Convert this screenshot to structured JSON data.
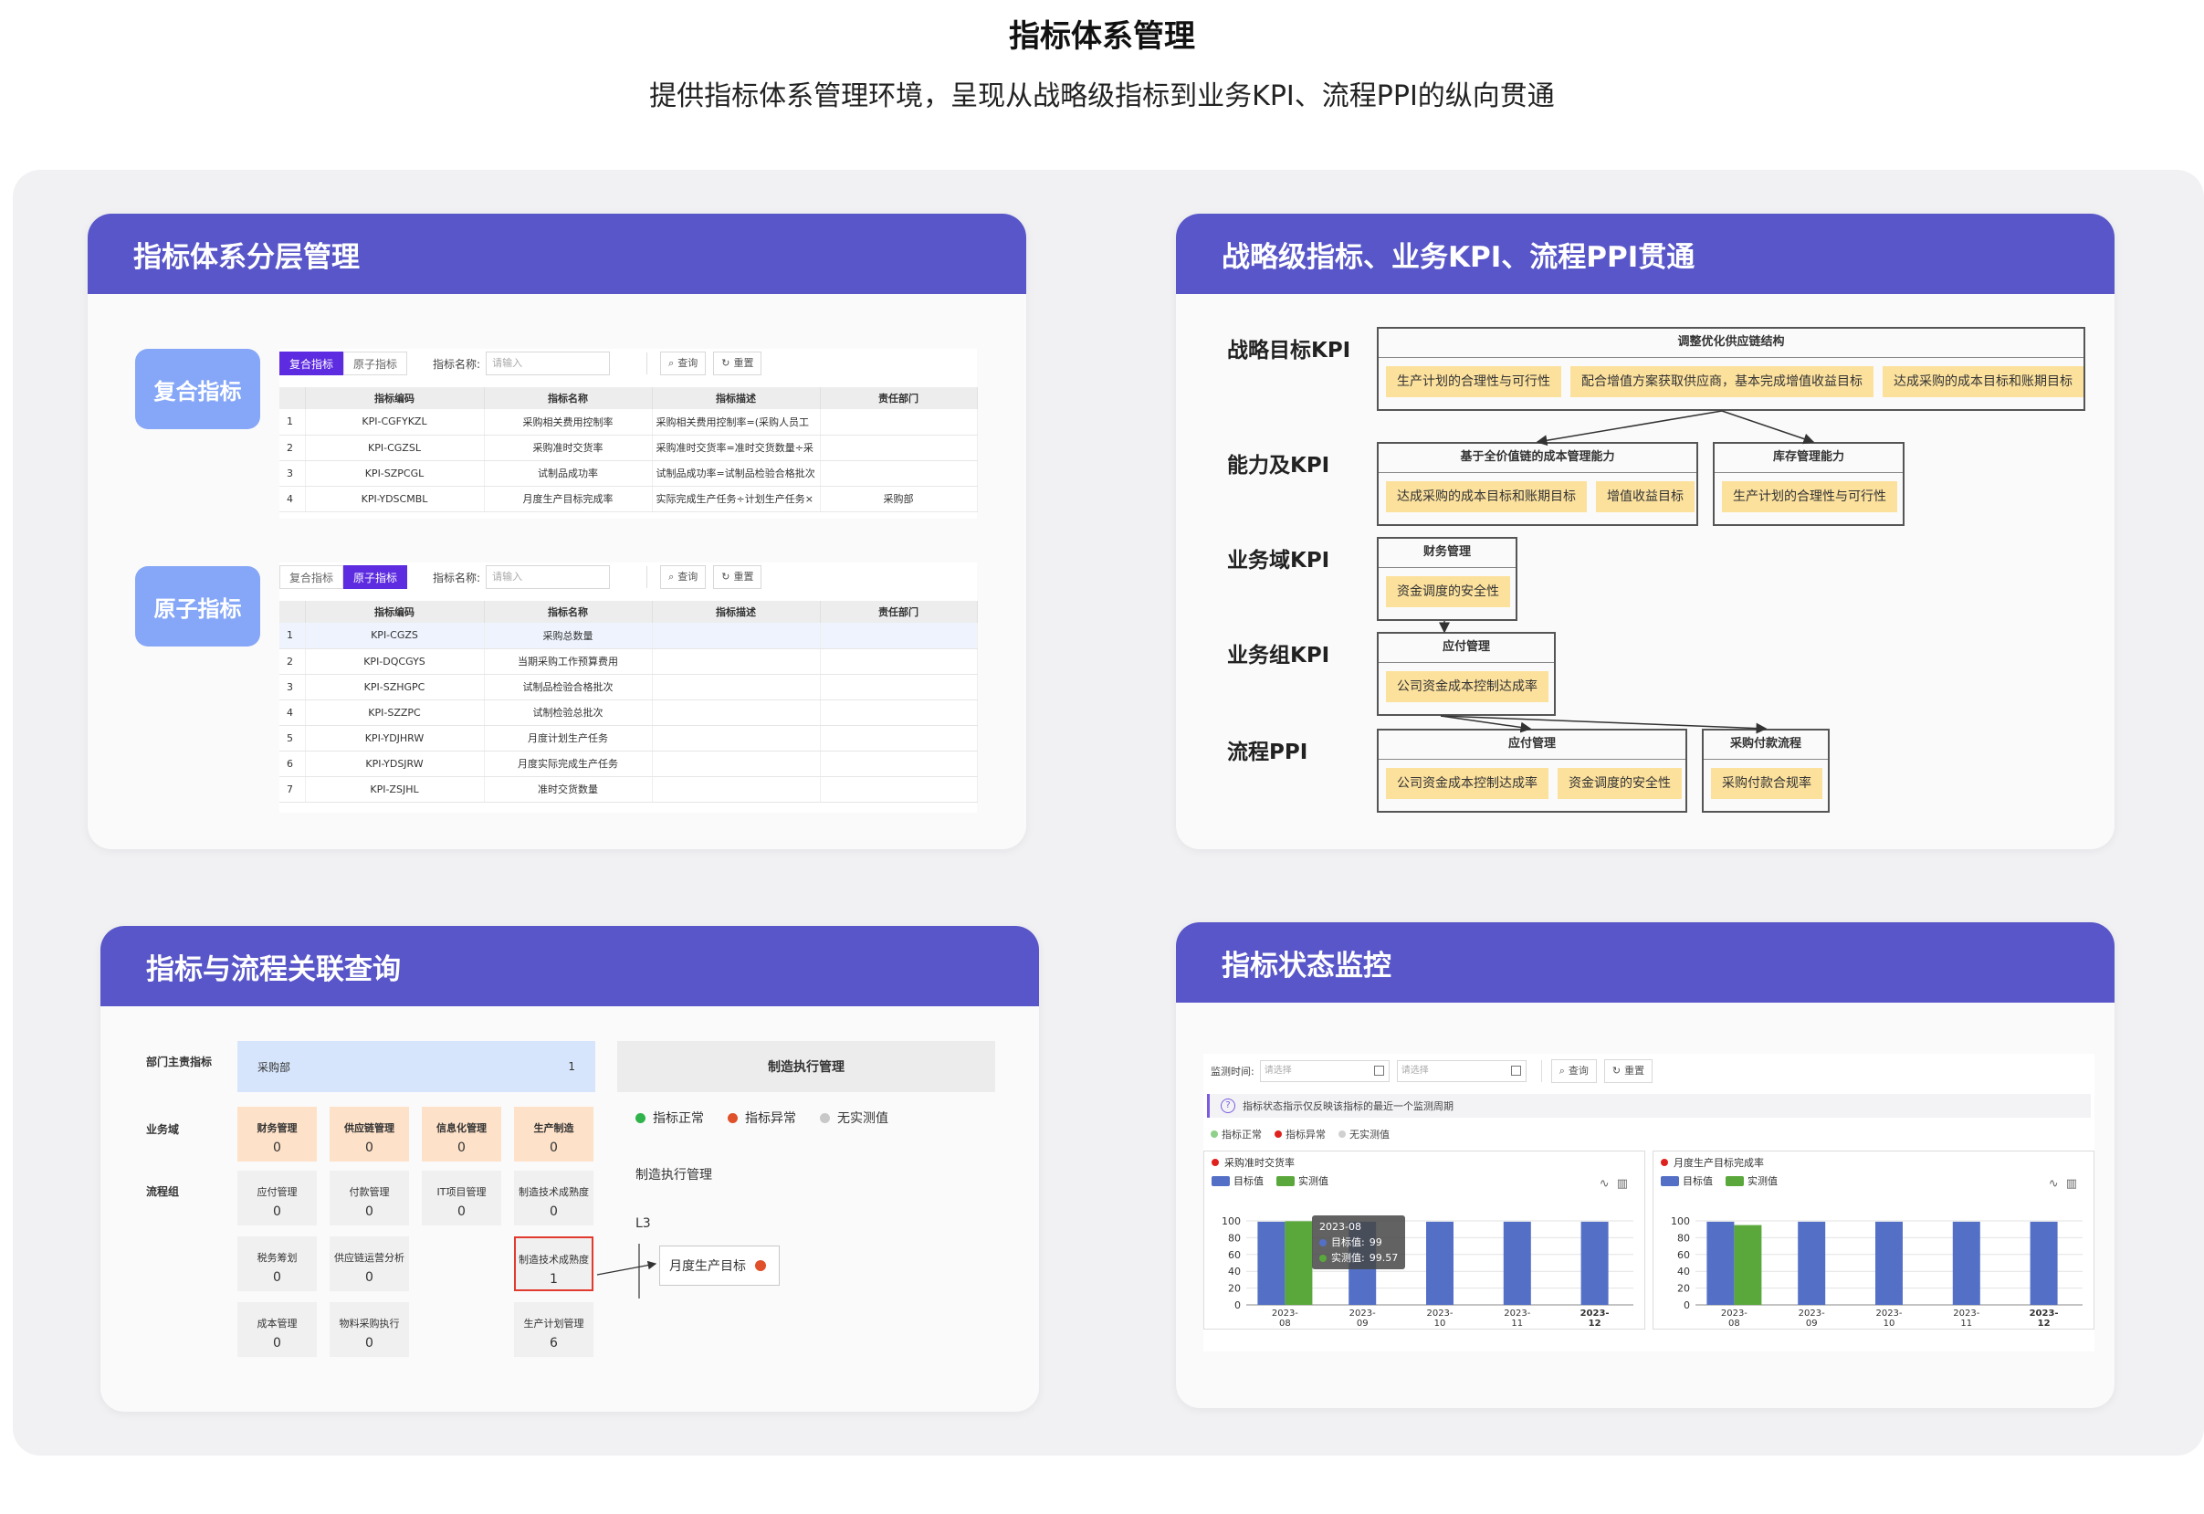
{
  "page": {
    "title": "指标体系管理",
    "subtitle": "提供指标体系管理环境，呈现从战略级指标到业务KPI、流程PPI的纵向贯通"
  },
  "card1": {
    "title": "指标体系分层管理",
    "composite_label": "复合指标",
    "atomic_label": "原子指标",
    "tabs": [
      "复合指标",
      "原子指标"
    ],
    "name_label": "指标名称:",
    "placeholder": "请输入",
    "query": "查询",
    "reset": "重置",
    "columns": [
      "",
      "指标编码",
      "指标名称",
      "指标描述",
      "责任部门"
    ],
    "composite_rows": [
      [
        "1",
        "KPI-CGFYKZL",
        "采购相关费用控制率",
        "采购相关费用控制率=(采购人员工",
        ""
      ],
      [
        "2",
        "KPI-CGZSL",
        "采购准时交货率",
        "采购准时交货率=准时交货数量÷采",
        ""
      ],
      [
        "3",
        "KPI-SZPCGL",
        "试制品成功率",
        "试制品成功率=试制品检验合格批次",
        ""
      ],
      [
        "4",
        "KPI-YDSCMBL",
        "月度生产目标完成率",
        "实际完成生产任务÷计划生产任务×",
        "采购部"
      ]
    ],
    "atomic_rows": [
      [
        "1",
        "KPI-CGZS",
        "采购总数量",
        "",
        ""
      ],
      [
        "2",
        "KPI-DQCGYS",
        "当期采购工作预算费用",
        "",
        ""
      ],
      [
        "3",
        "KPI-SZHGPC",
        "试制品检验合格批次",
        "",
        ""
      ],
      [
        "4",
        "KPI-SZZPC",
        "试制检验总批次",
        "",
        ""
      ],
      [
        "5",
        "KPI-YDJHRW",
        "月度计划生产任务",
        "",
        ""
      ],
      [
        "6",
        "KPI-YDSJRW",
        "月度实际完成生产任务",
        "",
        ""
      ],
      [
        "7",
        "KPI-ZSJHL",
        "准时交货数量",
        "",
        ""
      ]
    ]
  },
  "card2": {
    "title": "战略级指标、业务KPI、流程PPI贯通",
    "levels": [
      "战略目标KPI",
      "能力及KPI",
      "业务域KPI",
      "业务组KPI",
      "流程PPI"
    ],
    "strategy": {
      "title": "调整优化供应链结构",
      "items": [
        "生产计划的合理性与可行性",
        "配合增值方案获取供应商，基本完成增值收益目标",
        "达成采购的成本目标和账期目标"
      ]
    },
    "ability1": {
      "title": "基于全价值链的成本管理能力",
      "items": [
        "达成采购的成本目标和账期目标",
        "增值收益目标"
      ]
    },
    "ability2": {
      "title": "库存管理能力",
      "items": [
        "生产计划的合理性与可行性"
      ]
    },
    "domain": {
      "title": "财务管理",
      "items": [
        "资金调度的安全性"
      ]
    },
    "group": {
      "title": "应付管理",
      "items": [
        "公司资金成本控制达成率"
      ]
    },
    "ppi1": {
      "title": "应付管理",
      "items": [
        "公司资金成本控制达成率",
        "资金调度的安全性"
      ]
    },
    "ppi2": {
      "title": "采购付款流程",
      "items": [
        "采购付款合规率"
      ]
    }
  },
  "card3": {
    "title": "指标与流程关联查询",
    "row_labels": [
      "部门主责指标",
      "业务域",
      "流程组"
    ],
    "dept": {
      "name": "采购部",
      "count": "1"
    },
    "domains": [
      {
        "label": "财务管理",
        "value": "0"
      },
      {
        "label": "供应链管理",
        "value": "0"
      },
      {
        "label": "信息化管理",
        "value": "0"
      },
      {
        "label": "生产制造",
        "value": "0"
      }
    ],
    "groups": [
      {
        "label": "应付管理",
        "value": "0"
      },
      {
        "label": "付款管理",
        "value": "0"
      },
      {
        "label": "IT项目管理",
        "value": "0"
      },
      {
        "label": "制造技术成熟度",
        "value": "0"
      },
      {
        "label": "税务筹划",
        "value": "0"
      },
      {
        "label": "供应链运营分析",
        "value": "0"
      },
      {
        "label": "制造技术成熟度",
        "value": "1"
      },
      {
        "label": "成本管理",
        "value": "0"
      },
      {
        "label": "物料采购执行",
        "value": "0"
      },
      {
        "label": "生产计划管理",
        "value": "6"
      }
    ],
    "exec_title": "制造执行管理",
    "legend": [
      {
        "label": "指标正常",
        "color": "#2fb34a"
      },
      {
        "label": "指标异常",
        "color": "#e0502a"
      },
      {
        "label": "无实测值",
        "color": "#c8c8c8"
      }
    ],
    "exec_sub": "制造执行管理",
    "level": "L3",
    "goal": "月度生产目标",
    "goal_color": "#e0502a"
  },
  "card4": {
    "title": "指标状态监控",
    "period_label": "监测时间:",
    "date_placeholder": "请选择",
    "query": "查询",
    "reset": "重置",
    "hint": "指标状态指示仅反映该指标的最近一个监测周期",
    "legend": [
      {
        "label": "指标正常",
        "color": "#8fd08a"
      },
      {
        "label": "指标异常",
        "color": "#e0221e"
      },
      {
        "label": "无实测值",
        "color": "#d0d0d0"
      }
    ],
    "series_names": [
      "目标值",
      "实测值"
    ],
    "colors": {
      "target": "#5470c6",
      "actual": "#5aa83c"
    },
    "tooltip": {
      "date": "2023-08",
      "target_label": "目标值:",
      "target": "99",
      "actual_label": "实测值:",
      "actual": "99.57"
    }
  },
  "chart_data": [
    {
      "type": "bar",
      "title": "采购准时交货率",
      "categories": [
        "2023-08",
        "2023-09",
        "2023-10",
        "2023-11",
        "2023-12"
      ],
      "series": [
        {
          "name": "目标值",
          "values": [
            99,
            99,
            99,
            99,
            99
          ]
        },
        {
          "name": "实测值",
          "values": [
            99.57,
            null,
            null,
            null,
            null
          ]
        }
      ],
      "ylim": [
        0,
        100
      ],
      "yticks": [
        0,
        20,
        40,
        60,
        80,
        100
      ],
      "grid": true,
      "legend": "top-left"
    },
    {
      "type": "bar",
      "title": "月度生产目标完成率",
      "categories": [
        "2023-08",
        "2023-09",
        "2023-10",
        "2023-11",
        "2023-12"
      ],
      "series": [
        {
          "name": "目标值",
          "values": [
            99,
            99,
            99,
            99,
            99
          ]
        },
        {
          "name": "实测值",
          "values": [
            95,
            null,
            null,
            null,
            null
          ]
        }
      ],
      "ylim": [
        0,
        100
      ],
      "yticks": [
        0,
        20,
        40,
        60,
        80,
        100
      ],
      "grid": true,
      "legend": "top-left"
    }
  ]
}
